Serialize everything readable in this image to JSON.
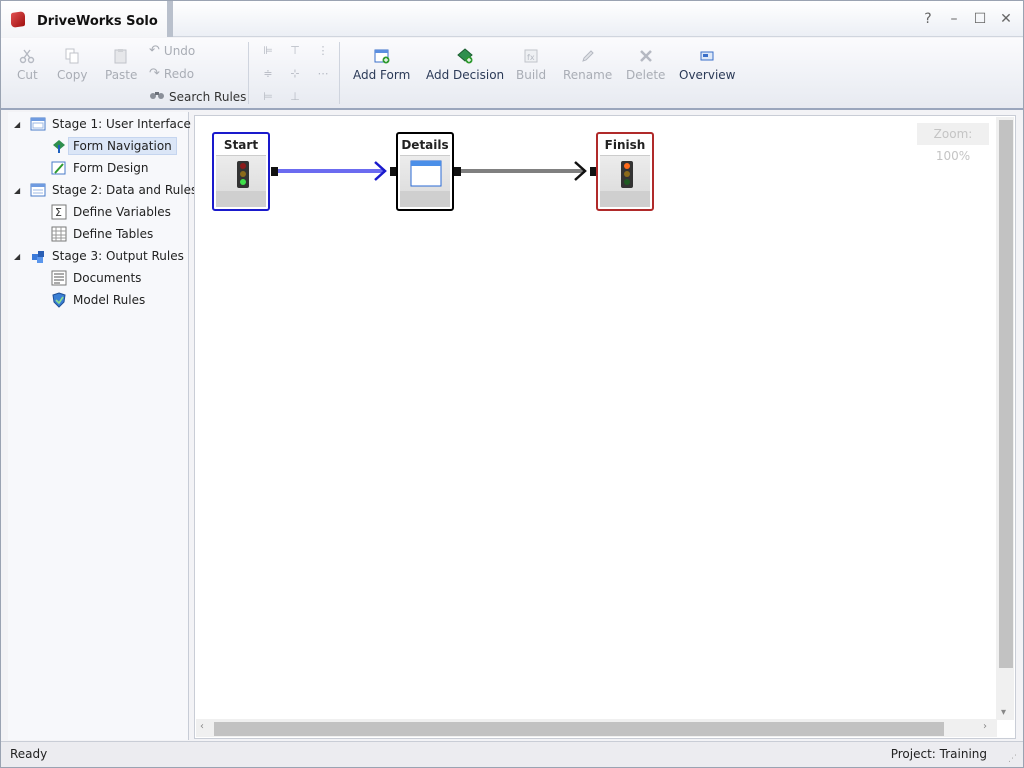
{
  "app": {
    "title": "DriveWorks Solo"
  },
  "window_controls": {
    "help": "?",
    "minimize": "–",
    "maximize": "☐",
    "close": "✕"
  },
  "ribbon": {
    "clipboard": {
      "cut": "Cut",
      "copy": "Copy",
      "paste": "Paste"
    },
    "history": {
      "undo": "Undo",
      "redo": "Redo",
      "search_rules": "Search Rules"
    },
    "actions": {
      "add_form": "Add Form",
      "add_decision": "Add Decision",
      "build": "Build",
      "rename": "Rename",
      "delete": "Delete",
      "overview": "Overview"
    }
  },
  "tree": {
    "stages": [
      {
        "label": "Stage 1: User Interface",
        "children": [
          "Form Navigation",
          "Form Design"
        ]
      },
      {
        "label": "Stage 2: Data and Rules",
        "children": [
          "Define Variables",
          "Define Tables"
        ]
      },
      {
        "label": "Stage 3: Output Rules",
        "children": [
          "Documents",
          "Model Rules"
        ]
      }
    ],
    "selected": "Form Navigation"
  },
  "canvas": {
    "zoom_label": "Zoom: 100%",
    "nodes": [
      {
        "title": "Start",
        "type": "start",
        "border_color": "#1a1acc"
      },
      {
        "title": "Details",
        "type": "form",
        "border_color": "#000000"
      },
      {
        "title": "Finish",
        "type": "finish",
        "border_color": "#b02a2a"
      }
    ],
    "connector_colors": {
      "selected": "#6b6bf0",
      "default": "#808080"
    }
  },
  "status": {
    "left": "Ready",
    "right": "Project: Training"
  }
}
